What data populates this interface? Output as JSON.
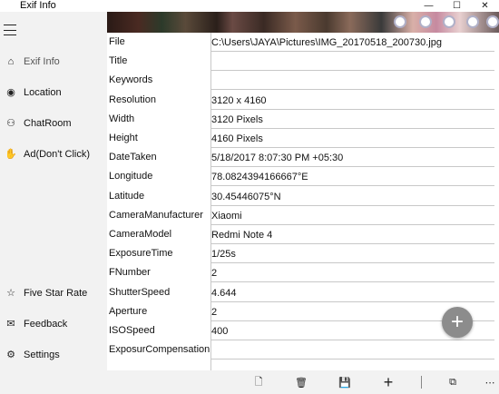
{
  "window": {
    "title": "Exif Info",
    "controls": {
      "minimize": "—",
      "maximize": "☐",
      "close": "✕"
    }
  },
  "sidebar": {
    "menu_icon": "hamburger-icon",
    "items": [
      {
        "label": "Exif Info",
        "icon": "home-icon",
        "glyph": "⌂",
        "active": true
      },
      {
        "label": "Location",
        "icon": "globe-icon",
        "glyph": "◉",
        "active": false
      },
      {
        "label": "ChatRoom",
        "icon": "people-icon",
        "glyph": "⚇",
        "active": false
      },
      {
        "label": "Ad(Don't Click)",
        "icon": "dislike-icon",
        "glyph": "✋",
        "active": false
      }
    ],
    "bottom_items": [
      {
        "label": "Five Star Rate",
        "icon": "star-icon",
        "glyph": "☆"
      },
      {
        "label": "Feedback",
        "icon": "mail-icon",
        "glyph": "✉"
      },
      {
        "label": "Settings",
        "icon": "gear-icon",
        "glyph": "⚙"
      }
    ]
  },
  "properties": [
    {
      "label": "File",
      "value": "C:\\Users\\JAYA\\Pictures\\IMG_20170518_200730.jpg"
    },
    {
      "label": "Title",
      "value": ""
    },
    {
      "label": "Keywords",
      "value": ""
    },
    {
      "label": "Resolution",
      "value": "3120 x 4160"
    },
    {
      "label": "Width",
      "value": "3120 Pixels"
    },
    {
      "label": "Height",
      "value": "4160 Pixels"
    },
    {
      "label": "DateTaken",
      "value": "5/18/2017 8:07:30 PM +05:30"
    },
    {
      "label": "Longitude",
      "value": "78.0824394166667°E"
    },
    {
      "label": "Latitude",
      "value": "30.45446075°N"
    },
    {
      "label": "CameraManufacturer",
      "value": "Xiaomi"
    },
    {
      "label": "CameraModel",
      "value": "Redmi Note 4"
    },
    {
      "label": "ExposureTime",
      "value": "1/25s"
    },
    {
      "label": "FNumber",
      "value": "2"
    },
    {
      "label": "ShutterSpeed",
      "value": "4.644"
    },
    {
      "label": "Aperture",
      "value": "2"
    },
    {
      "label": "ISOSpeed",
      "value": "400"
    },
    {
      "label": "ExposurCompensation",
      "value": ""
    },
    {
      "label": "",
      "value": ""
    }
  ],
  "fab": {
    "icon": "add-icon",
    "glyph": "+"
  },
  "commands": [
    {
      "name": "new-file-icon",
      "glyph": "🗋"
    },
    {
      "name": "delete-icon",
      "glyph": "🗑"
    },
    {
      "name": "save-icon",
      "glyph": "💾"
    },
    {
      "name": "add-icon",
      "glyph": "+"
    },
    {
      "name": "slideshow-icon",
      "glyph": "⧉"
    },
    {
      "name": "more-icon",
      "glyph": "⋯"
    }
  ],
  "colors": {
    "sidebar_bg": "#f2f2f2",
    "fab_bg": "#8c8c8c",
    "divider": "#c8c8c8"
  }
}
